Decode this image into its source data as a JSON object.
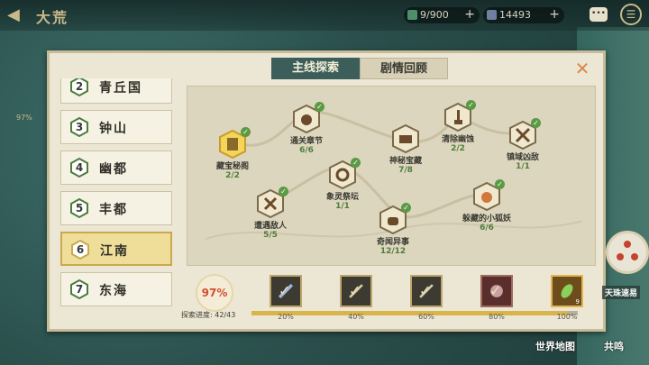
{
  "header": {
    "back_icon": "back-arrow-icon",
    "region_title": "大荒",
    "jade": "9/900",
    "coins": "14493",
    "side_percent": "97%"
  },
  "tabs": [
    {
      "label": "主线探索",
      "active": true
    },
    {
      "label": "剧情回顾",
      "active": false
    }
  ],
  "regions": [
    {
      "num": "2",
      "name": "青丘国"
    },
    {
      "num": "3",
      "name": "钟山"
    },
    {
      "num": "4",
      "name": "幽都"
    },
    {
      "num": "5",
      "name": "丰都"
    },
    {
      "num": "6",
      "name": "江南",
      "active": true
    },
    {
      "num": "7",
      "name": "东海"
    }
  ],
  "nodes": [
    {
      "label": "藏宝秘阁",
      "count": "2/2",
      "icon": "scroll-icon",
      "selected": true
    },
    {
      "label": "通关章节",
      "count": "6/6",
      "icon": "coin-bag-icon"
    },
    {
      "label": "神秘宝藏",
      "count": "7/8",
      "icon": "treasure-chest-icon"
    },
    {
      "label": "清除幽蚀",
      "count": "2/2",
      "icon": "shovel-icon"
    },
    {
      "label": "镇域凶敌",
      "count": "1/1",
      "icon": "crossed-swords-icon"
    },
    {
      "label": "象灵祭坛",
      "count": "1/1",
      "icon": "altar-icon"
    },
    {
      "label": "遭遇敌人",
      "count": "5/5",
      "icon": "swords-icon"
    },
    {
      "label": "躲藏的小狐妖",
      "count": "6/6",
      "icon": "fox-icon"
    },
    {
      "label": "奇闻异事",
      "count": "12/12",
      "icon": "pot-icon"
    }
  ],
  "progress": {
    "percent_label": "97%",
    "label": "探索进度: 42/43",
    "fill_fraction": 0.97
  },
  "rewards": [
    {
      "pct": "20%",
      "icon": "feather-blade-icon",
      "claimed": true
    },
    {
      "pct": "40%",
      "icon": "sword-icon",
      "claimed": true
    },
    {
      "pct": "60%",
      "icon": "sword-icon",
      "claimed": true
    },
    {
      "pct": "80%",
      "icon": "emblem-icon",
      "claimed": true
    },
    {
      "pct": "100%",
      "icon": "green-leaf-icon",
      "claimed": false,
      "count": "9"
    }
  ],
  "side": {
    "tianzhu_label": "天珠速易",
    "world_map": "世界地图",
    "resonance": "共鸣"
  },
  "colors": {
    "accent_tab": "#3b5e5a",
    "check_green": "#5b9a44",
    "percent_red": "#d24f2f",
    "progress_gold": "#d9b44a"
  }
}
